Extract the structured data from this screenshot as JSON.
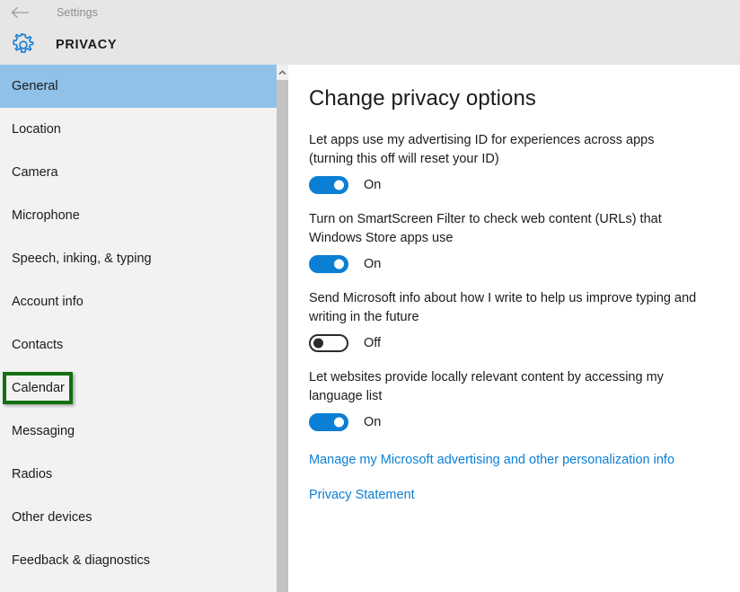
{
  "titlebar": {
    "back_icon": "back-arrow-icon",
    "title": "Settings"
  },
  "header": {
    "icon": "gear-icon",
    "title": "PRIVACY"
  },
  "sidebar": {
    "scrollbar_up_icon": "chevron-up-icon",
    "items": [
      {
        "label": "General",
        "selected": true
      },
      {
        "label": "Location",
        "selected": false
      },
      {
        "label": "Camera",
        "selected": false
      },
      {
        "label": "Microphone",
        "selected": false
      },
      {
        "label": "Speech, inking, & typing",
        "selected": false
      },
      {
        "label": "Account info",
        "selected": false
      },
      {
        "label": "Contacts",
        "selected": false
      },
      {
        "label": "Calendar",
        "selected": false
      },
      {
        "label": "Messaging",
        "selected": false
      },
      {
        "label": "Radios",
        "selected": false
      },
      {
        "label": "Other devices",
        "selected": false
      },
      {
        "label": "Feedback & diagnostics",
        "selected": false
      }
    ],
    "annotation": {
      "target": "Calendar",
      "color": "#127012"
    }
  },
  "main": {
    "heading": "Change privacy options",
    "settings": [
      {
        "label": "Let apps use my advertising ID for experiences across apps (turning this off will reset your ID)",
        "state": "On",
        "on": true
      },
      {
        "label": "Turn on SmartScreen Filter to check web content (URLs) that Windows Store apps use",
        "state": "On",
        "on": true
      },
      {
        "label": "Send Microsoft info about how I write to help us improve typing and writing in the future",
        "state": "Off",
        "on": false
      },
      {
        "label": "Let websites provide locally relevant content by accessing my language list",
        "state": "On",
        "on": true
      }
    ],
    "links": [
      "Manage my Microsoft advertising and other personalization info",
      "Privacy Statement"
    ]
  },
  "colors": {
    "accent": "#0b7fd4",
    "selection": "#8fc1e9",
    "header_bg": "#e6e6e6",
    "sidebar_bg": "#f2f2f2",
    "annotation": "#127012"
  }
}
